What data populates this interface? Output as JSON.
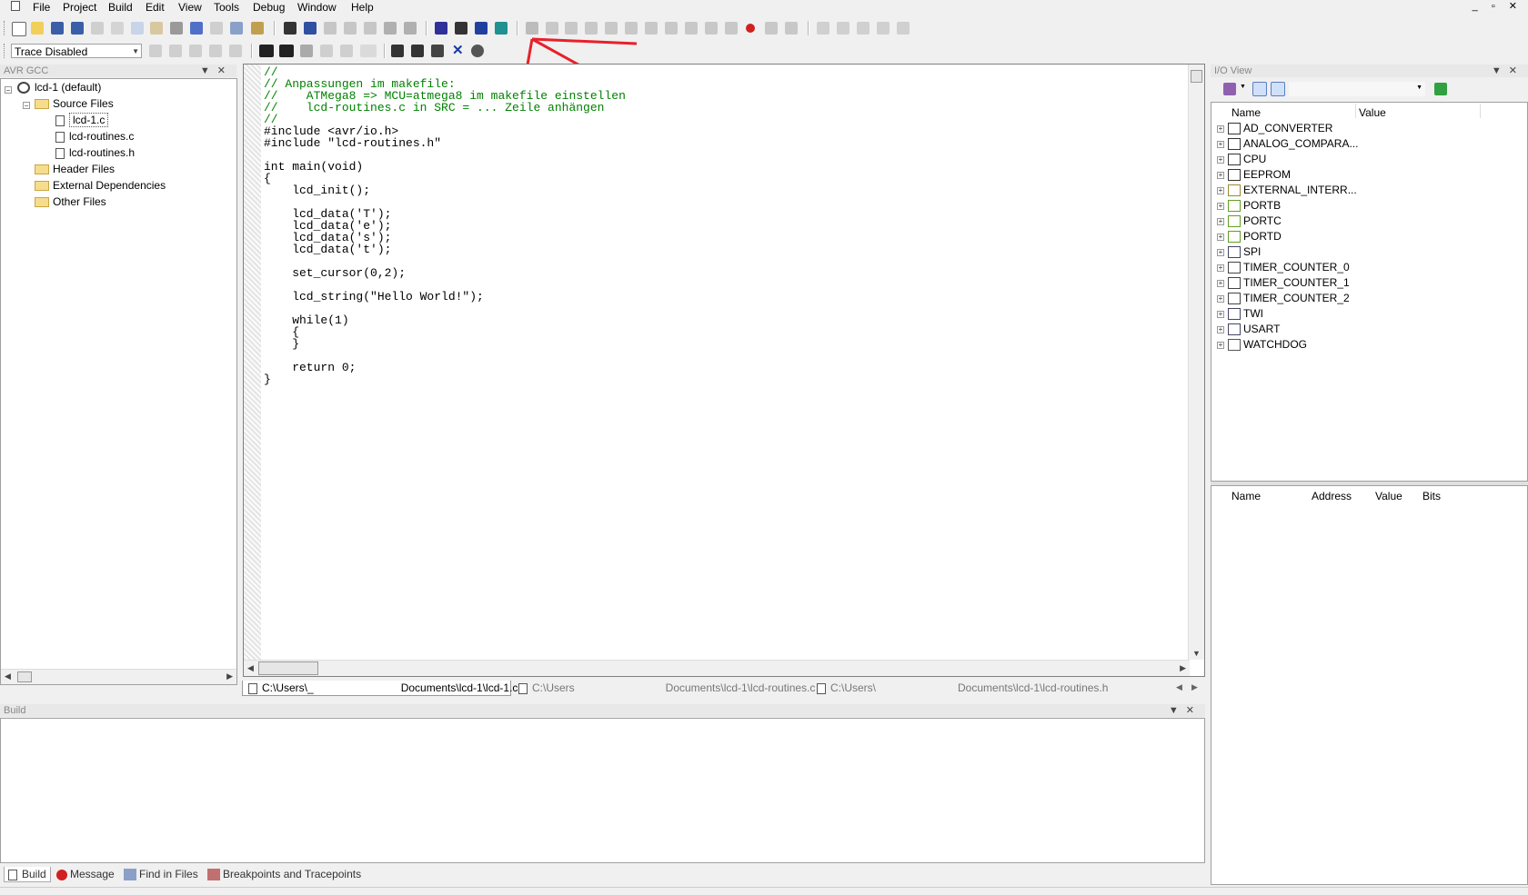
{
  "menu": {
    "items": [
      "File",
      "Project",
      "Build",
      "Edit",
      "View",
      "Tools",
      "Debug",
      "Window",
      "Help"
    ]
  },
  "toolbar": {
    "trace_combo": "Trace Disabled"
  },
  "project_panel": {
    "title": "AVR GCC",
    "project": "lcd-1 (default)",
    "folders": {
      "source": "Source Files",
      "header": "Header Files",
      "external": "External Dependencies",
      "other": "Other Files"
    },
    "files": [
      "lcd-1.c",
      "lcd-routines.c",
      "lcd-routines.h"
    ]
  },
  "editor": {
    "lines": [
      {
        "t": "//",
        "c": "cm"
      },
      {
        "t": "// Anpassungen im makefile:",
        "c": "cm"
      },
      {
        "t": "//    ATMega8 => MCU=atmega8 im makefile einstellen",
        "c": "cm"
      },
      {
        "t": "//    lcd-routines.c in SRC = ... Zeile anhängen",
        "c": "cm"
      },
      {
        "t": "//",
        "c": "cm"
      },
      {
        "t": "#include <avr/io.h>",
        "c": ""
      },
      {
        "t": "#include \"lcd-routines.h\"",
        "c": ""
      },
      {
        "t": "",
        "c": ""
      },
      {
        "t": "int main(void)",
        "c": ""
      },
      {
        "t": "{",
        "c": ""
      },
      {
        "t": "    lcd_init();",
        "c": ""
      },
      {
        "t": "",
        "c": ""
      },
      {
        "t": "    lcd_data('T');",
        "c": ""
      },
      {
        "t": "    lcd_data('e');",
        "c": ""
      },
      {
        "t": "    lcd_data('s');",
        "c": ""
      },
      {
        "t": "    lcd_data('t');",
        "c": ""
      },
      {
        "t": "",
        "c": ""
      },
      {
        "t": "    set_cursor(0,2);",
        "c": ""
      },
      {
        "t": "",
        "c": ""
      },
      {
        "t": "    lcd_string(\"Hello World!\");",
        "c": ""
      },
      {
        "t": "",
        "c": ""
      },
      {
        "t": "    while(1)",
        "c": ""
      },
      {
        "t": "    {",
        "c": ""
      },
      {
        "t": "    }",
        "c": ""
      },
      {
        "t": "",
        "c": ""
      },
      {
        "t": "    return 0;",
        "c": ""
      },
      {
        "t": "}",
        "c": ""
      }
    ]
  },
  "doc_tabs": {
    "tab1_a": "C:\\Users\\_",
    "tab1_b": "Documents\\lcd-1\\lcd-1.c",
    "tab2_a": "C:\\Users",
    "tab2_b": "Documents\\lcd-1\\lcd-routines.c",
    "tab3_a": "C:\\Users\\",
    "tab3_b": "Documents\\lcd-1\\lcd-routines.h"
  },
  "io_view": {
    "title": "I/O View",
    "col_name": "Name",
    "col_value": "Value",
    "items": [
      "AD_CONVERTER",
      "ANALOG_COMPARA...",
      "CPU",
      "EEPROM",
      "EXTERNAL_INTERR...",
      "PORTB",
      "PORTC",
      "PORTD",
      "SPI",
      "TIMER_COUNTER_0",
      "TIMER_COUNTER_1",
      "TIMER_COUNTER_2",
      "TWI",
      "USART",
      "WATCHDOG"
    ],
    "detail_cols": {
      "name": "Name",
      "address": "Address",
      "value": "Value",
      "bits": "Bits"
    }
  },
  "build_panel": {
    "title": "Build",
    "tabs": [
      "Build",
      "Message",
      "Find in Files",
      "Breakpoints and Tracepoints"
    ]
  },
  "colors": {
    "annotation_red": "#e8202a",
    "comment_green": "#008000"
  }
}
